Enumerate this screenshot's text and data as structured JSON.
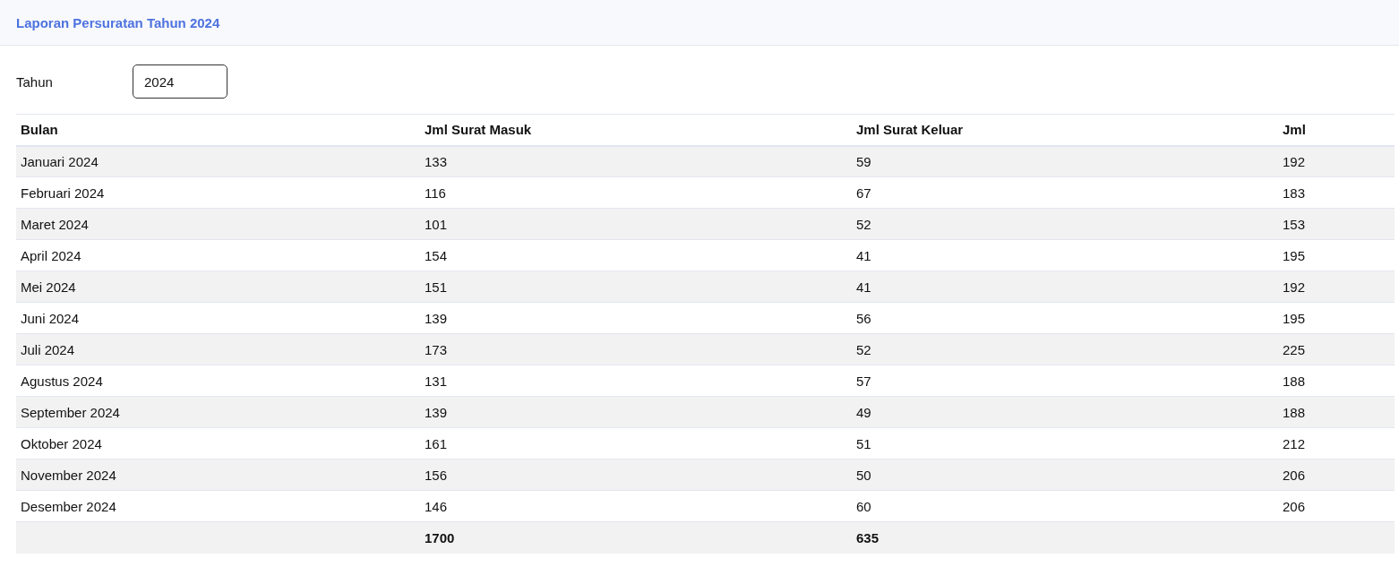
{
  "header": {
    "title": "Laporan Persuratan Tahun 2024"
  },
  "filter": {
    "label": "Tahun",
    "value": "2024"
  },
  "table": {
    "columns": [
      "Bulan",
      "Jml Surat Masuk",
      "Jml Surat Keluar",
      "Jml"
    ],
    "rows": [
      [
        "Januari 2024",
        "133",
        "59",
        "192"
      ],
      [
        "Februari 2024",
        "116",
        "67",
        "183"
      ],
      [
        "Maret 2024",
        "101",
        "52",
        "153"
      ],
      [
        "April 2024",
        "154",
        "41",
        "195"
      ],
      [
        "Mei 2024",
        "151",
        "41",
        "192"
      ],
      [
        "Juni 2024",
        "139",
        "56",
        "195"
      ],
      [
        "Juli 2024",
        "173",
        "52",
        "225"
      ],
      [
        "Agustus 2024",
        "131",
        "57",
        "188"
      ],
      [
        "September 2024",
        "139",
        "49",
        "188"
      ],
      [
        "Oktober 2024",
        "161",
        "51",
        "212"
      ],
      [
        "November 2024",
        "156",
        "50",
        "206"
      ],
      [
        "Desember 2024",
        "146",
        "60",
        "206"
      ]
    ],
    "footer": {
      "total_masuk": "1700",
      "total_keluar": "635"
    }
  }
}
